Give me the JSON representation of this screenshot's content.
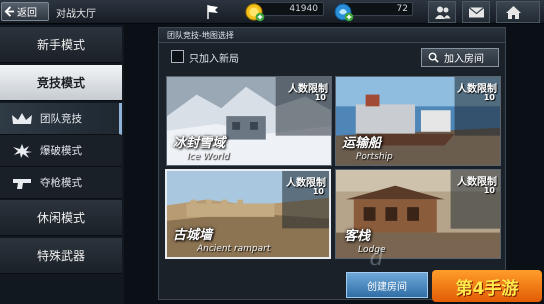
{
  "topbar": {
    "back_label": "返回",
    "title": "对战大厅",
    "coins": "41940",
    "gems": "72"
  },
  "menu": {
    "newbie": "新手模式",
    "competitive": "竞技模式",
    "sub_team": "团队竞技",
    "sub_bomb": "爆破模式",
    "sub_gun": "夺枪模式",
    "casual": "休闲模式",
    "special": "特殊武器"
  },
  "panel": {
    "header": "团队竞技-地图选择",
    "checkbox_label": "只加入新局",
    "join_label": "加入房间",
    "create_label": "创建房间"
  },
  "maps": [
    {
      "cn": "冰封雪域",
      "en": "Ice World",
      "limit_label": "人数限制",
      "limit": "10"
    },
    {
      "cn": "运输船",
      "en": "Portship",
      "limit_label": "人数限制",
      "limit": "10"
    },
    {
      "cn": "古城墙",
      "en": "Ancient rampart",
      "limit_label": "人数限制",
      "limit": "10"
    },
    {
      "cn": "客栈",
      "en": "Lodge",
      "limit_label": "人数限制",
      "limit": "10"
    }
  ],
  "watermark": {
    "logo_text": "第4手游"
  },
  "colors": {
    "accent": "#2f6ea6",
    "active_menu": "#e4e8ec",
    "logo": "#ff7a12"
  }
}
